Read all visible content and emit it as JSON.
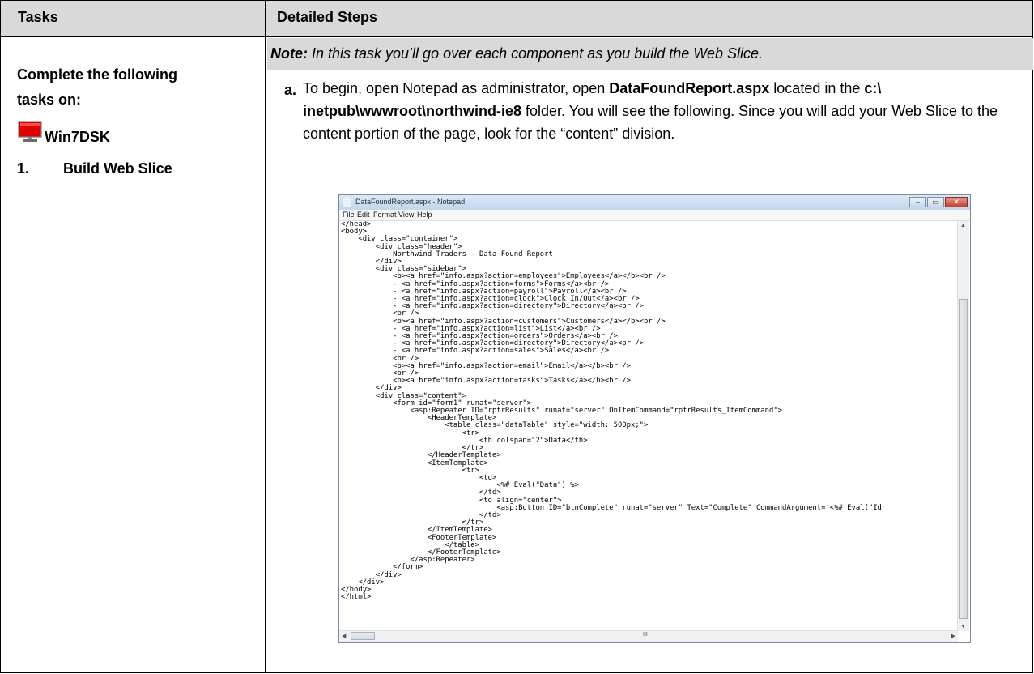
{
  "header": {
    "tasks": "Tasks",
    "steps": "Detailed Steps"
  },
  "left": {
    "line1": "Complete the following",
    "line2": "tasks on:",
    "vm_name": "Win7DSK",
    "task_number": "1.",
    "task_title": "Build Web Slice",
    "vm_icon": "monitor-icon"
  },
  "note": {
    "label": "Note:",
    "text": " In this task you’ll go over each component as you build the Web Slice."
  },
  "step": {
    "letter": "a.",
    "text_1": "To begin, open Notepad as administrator, open ",
    "file": "DataFoundReport.aspx",
    "text_2": " located in the ",
    "folder": "c:\\ inetpub\\wwwroot\\northwind-ie8",
    "text_3": " folder. You will see the following. Since you will add your Web Slice to the content portion of the page, look for the “content” division."
  },
  "notepad": {
    "title": "DataFoundReport.aspx - Notepad",
    "menu": [
      "File",
      "Edit",
      "Format",
      "View",
      "Help"
    ],
    "controls": [
      "–",
      "▭",
      "✕"
    ],
    "code": [
      "</head>",
      "<body>",
      "    <div class=\"container\">",
      "        <div class=\"header\">",
      "            Northwind Traders - Data Found Report",
      "        </div>",
      "        <div class=\"sidebar\">",
      "            <b><a href=\"info.aspx?action=employees\">Employees</a></b><br />",
      "            - <a href=\"info.aspx?action=forms\">Forms</a><br />",
      "            - <a href=\"info.aspx?action=payroll\">Payroll</a><br />",
      "            - <a href=\"info.aspx?action=clock\">Clock In/Out</a><br />",
      "            - <a href=\"info.aspx?action=directory\">Directory</a><br />",
      "            <br />",
      "            <b><a href=\"info.aspx?action=customers\">Customers</a></b><br />",
      "            - <a href=\"info.aspx?action=list\">List</a><br />",
      "            - <a href=\"info.aspx?action=orders\">Orders</a><br />",
      "            - <a href=\"info.aspx?action=directory\">Directory</a><br />",
      "            - <a href=\"info.aspx?action=sales\">Sales</a><br />",
      "            <br />",
      "            <b><a href=\"info.aspx?action=email\">Email</a></b><br />",
      "            <br />",
      "            <b><a href=\"info.aspx?action=tasks\">Tasks</a></b><br />",
      "        </div>",
      "        <div class=\"content\">",
      "            <form id=\"form1\" runat=\"server\">",
      "                <asp:Repeater ID=\"rptrResults\" runat=\"server\" OnItemCommand=\"rptrResults_ItemCommand\">",
      "                    <HeaderTemplate>",
      "                        <table class=\"dataTable\" style=\"width: 500px;\">",
      "                            <tr>",
      "                                <th colspan=\"2\">Data</th>",
      "                            </tr>",
      "                    </HeaderTemplate>",
      "                    <ItemTemplate>",
      "                            <tr>",
      "                                <td>",
      "                                    <%# Eval(\"Data\") %>",
      "                                </td>",
      "                                <td align=\"center\">",
      "                                    <asp:Button ID=\"btnComplete\" runat=\"server\" Text=\"Complete\" CommandArgument='<%# Eval(\"Id",
      "                                </td>",
      "                            </tr>",
      "                    </ItemTemplate>",
      "                    <FooterTemplate>",
      "                        </table>",
      "                    </FooterTemplate>",
      "                </asp:Repeater>",
      "            </form>",
      "        </div>",
      "    </div>",
      "</body>",
      "</html>"
    ],
    "hscroll_marker": "III"
  }
}
